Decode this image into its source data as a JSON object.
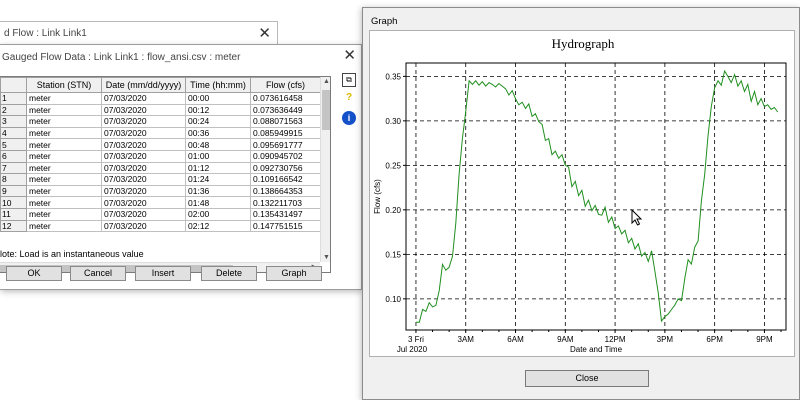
{
  "back_window": {
    "title": "d Flow : Link Link1"
  },
  "data_window": {
    "title": "Gauged Flow Data : Link Link1 : flow_ansi.csv : meter",
    "columns": [
      "Station (STN)",
      "Date (mm/dd/yyyy)",
      "Time (hh:mm)",
      "Flow (cfs)"
    ],
    "rows": [
      {
        "n": "1",
        "station": "meter",
        "date": "07/03/2020",
        "time": "00:00",
        "flow": "0.073616458"
      },
      {
        "n": "2",
        "station": "meter",
        "date": "07/03/2020",
        "time": "00:12",
        "flow": "0.073636449"
      },
      {
        "n": "3",
        "station": "meter",
        "date": "07/03/2020",
        "time": "00:24",
        "flow": "0.088071563"
      },
      {
        "n": "4",
        "station": "meter",
        "date": "07/03/2020",
        "time": "00:36",
        "flow": "0.085949915"
      },
      {
        "n": "5",
        "station": "meter",
        "date": "07/03/2020",
        "time": "00:48",
        "flow": "0.095691777"
      },
      {
        "n": "6",
        "station": "meter",
        "date": "07/03/2020",
        "time": "01:00",
        "flow": "0.090945702"
      },
      {
        "n": "7",
        "station": "meter",
        "date": "07/03/2020",
        "time": "01:12",
        "flow": "0.092730756"
      },
      {
        "n": "8",
        "station": "meter",
        "date": "07/03/2020",
        "time": "01:24",
        "flow": "0.109166542"
      },
      {
        "n": "9",
        "station": "meter",
        "date": "07/03/2020",
        "time": "01:36",
        "flow": "0.138664353"
      },
      {
        "n": "10",
        "station": "meter",
        "date": "07/03/2020",
        "time": "01:48",
        "flow": "0.132211703"
      },
      {
        "n": "11",
        "station": "meter",
        "date": "07/03/2020",
        "time": "02:00",
        "flow": "0.135431497"
      },
      {
        "n": "12",
        "station": "meter",
        "date": "07/03/2020",
        "time": "02:12",
        "flow": "0.147751515"
      }
    ],
    "note": "lote: Load is an instantaneous value",
    "buttons": {
      "ok": "OK",
      "cancel": "Cancel",
      "insert": "Insert",
      "delete": "Delete",
      "graph": "Graph"
    },
    "icons": [
      "copy-icon",
      "hint-icon",
      "info-icon"
    ]
  },
  "graph_window": {
    "title": "Graph",
    "close_label": "Close",
    "chart_data": {
      "type": "line",
      "title": "Hydrograph",
      "xlabel": "Date and Time",
      "ylabel": "Flow (cfs)",
      "x_ticks": [
        "3 Fri",
        "3AM",
        "6AM",
        "9AM",
        "12PM",
        "3PM",
        "6PM",
        "9PM"
      ],
      "x_tick_hours": [
        0,
        3,
        6,
        9,
        12,
        15,
        18,
        21
      ],
      "x_subtitle": "Jul 2020",
      "xlim_hours": [
        -0.6,
        22.3
      ],
      "y_ticks": [
        0.1,
        0.15,
        0.2,
        0.25,
        0.3,
        0.35
      ],
      "ylim": [
        0.065,
        0.365
      ],
      "grid": true,
      "line_color": "#1f8f1f",
      "series": [
        {
          "x_hours": [
            0,
            0.2,
            0.4,
            0.6,
            0.8,
            1.0,
            1.2,
            1.4,
            1.6,
            1.8,
            2.0,
            2.2,
            2.4,
            2.6,
            2.8,
            3.0,
            3.2,
            3.4,
            3.6,
            3.8,
            4.0,
            4.2,
            4.4,
            4.6,
            4.8,
            5.0,
            5.2,
            5.4,
            5.6,
            5.8,
            6.0,
            6.2,
            6.4,
            6.6,
            6.8,
            7.0,
            7.2,
            7.4,
            7.6,
            7.8,
            8.0,
            8.2,
            8.4,
            8.6,
            8.8,
            9.0,
            9.2,
            9.4,
            9.6,
            9.8,
            10.0,
            10.2,
            10.4,
            10.6,
            10.8,
            11.0,
            11.2,
            11.4,
            11.6,
            11.8,
            12.0,
            12.2,
            12.4,
            12.6,
            12.8,
            13.0,
            13.2,
            13.4,
            13.6,
            13.8,
            14.0,
            14.2,
            14.4,
            14.6,
            14.8,
            15.0,
            15.2,
            15.4,
            15.6,
            15.8,
            16.0,
            16.2,
            16.4,
            16.6,
            16.8,
            17.0,
            17.2,
            17.4,
            17.6,
            17.8,
            18.0,
            18.2,
            18.4,
            18.6,
            18.8,
            19.0,
            19.2,
            19.4,
            19.6,
            19.8,
            20.0,
            20.2,
            20.4,
            20.6,
            20.8,
            21.0,
            21.2,
            21.4,
            21.6,
            21.8
          ],
          "y": [
            0.0736,
            0.0736,
            0.0881,
            0.0859,
            0.0957,
            0.0909,
            0.0927,
            0.1092,
            0.1387,
            0.1322,
            0.1354,
            0.1478,
            0.185,
            0.24,
            0.28,
            0.31,
            0.345,
            0.341,
            0.345,
            0.34,
            0.344,
            0.339,
            0.343,
            0.341,
            0.338,
            0.342,
            0.339,
            0.336,
            0.329,
            0.334,
            0.325,
            0.318,
            0.321,
            0.314,
            0.319,
            0.305,
            0.308,
            0.299,
            0.296,
            0.278,
            0.28,
            0.262,
            0.266,
            0.258,
            0.262,
            0.25,
            0.248,
            0.226,
            0.232,
            0.216,
            0.222,
            0.204,
            0.211,
            0.199,
            0.205,
            0.195,
            0.194,
            0.203,
            0.186,
            0.192,
            0.179,
            0.182,
            0.173,
            0.177,
            0.163,
            0.168,
            0.156,
            0.162,
            0.148,
            0.152,
            0.142,
            0.154,
            0.131,
            0.107,
            0.075,
            0.08,
            0.083,
            0.088,
            0.093,
            0.1,
            0.098,
            0.123,
            0.144,
            0.139,
            0.158,
            0.165,
            0.21,
            0.24,
            0.283,
            0.316,
            0.337,
            0.345,
            0.34,
            0.356,
            0.35,
            0.343,
            0.352,
            0.339,
            0.345,
            0.333,
            0.341,
            0.322,
            0.333,
            0.318,
            0.325,
            0.316,
            0.318,
            0.313,
            0.315,
            0.31
          ]
        }
      ]
    }
  }
}
